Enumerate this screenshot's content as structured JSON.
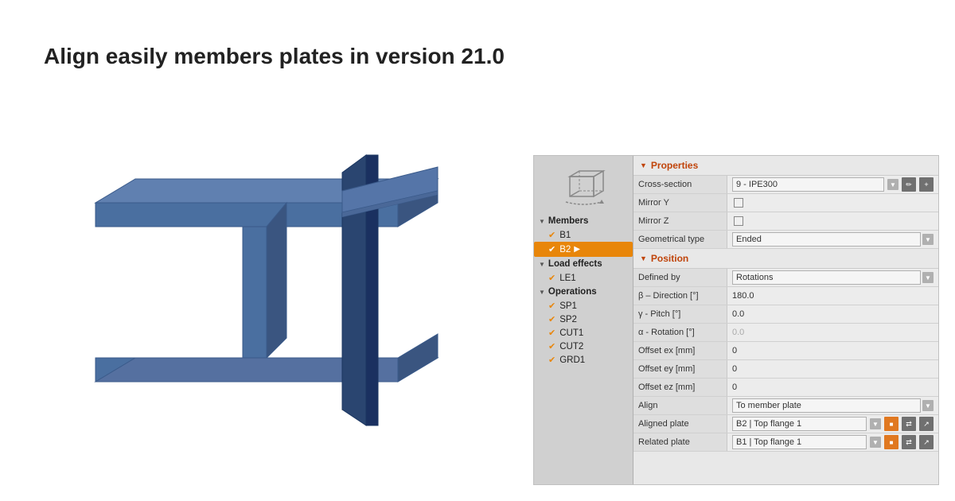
{
  "title": "Align easily members plates in version 21.0",
  "panel": {
    "sidebar": {
      "section_members": "Members",
      "item_b1": "B1",
      "item_b2": "B2",
      "section_load": "Load effects",
      "item_le1": "LE1",
      "section_operations": "Operations",
      "item_sp1": "SP1",
      "item_sp2": "SP2",
      "item_cut1": "CUT1",
      "item_cut2": "CUT2",
      "item_grd1": "GRD1"
    },
    "props": {
      "header_properties": "Properties",
      "label_cross_section": "Cross-section",
      "value_cross_section": "9 - IPE300",
      "label_mirror_y": "Mirror Y",
      "label_mirror_z": "Mirror Z",
      "label_geom_type": "Geometrical type",
      "value_geom_type": "Ended",
      "header_position": "Position",
      "label_defined_by": "Defined by",
      "value_defined_by": "Rotations",
      "label_direction": "β – Direction [°]",
      "value_direction": "180.0",
      "label_pitch": "γ - Pitch [°]",
      "value_pitch": "0.0",
      "label_rotation": "α - Rotation [°]",
      "value_rotation": "0.0",
      "label_offset_ex": "Offset ex [mm]",
      "value_offset_ex": "0",
      "label_offset_ey": "Offset ey [mm]",
      "value_offset_ey": "0",
      "label_offset_ez": "Offset ez [mm]",
      "value_offset_ez": "0",
      "label_align": "Align",
      "value_align": "To member plate",
      "label_aligned_plate": "Aligned plate",
      "value_aligned_plate": "B2 | Top flange 1",
      "label_related_plate": "Related plate",
      "value_related_plate": "B1 | Top flange 1"
    }
  }
}
